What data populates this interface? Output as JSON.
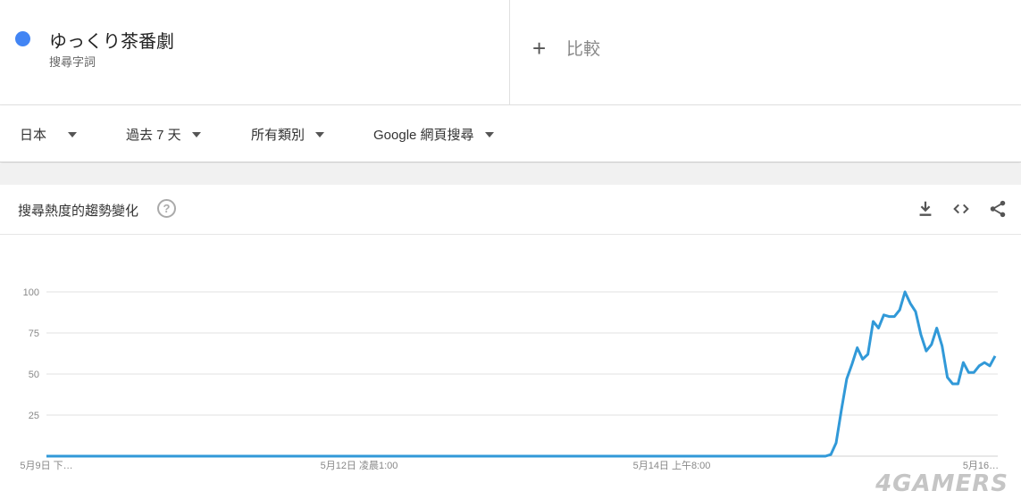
{
  "term": {
    "name": "ゆっくり茶番劇",
    "type": "搜尋字詞",
    "color": "#4285f4"
  },
  "compare": {
    "label": "比較",
    "icon": "plus-icon"
  },
  "filters": [
    {
      "label": "日本"
    },
    {
      "label": "過去 7 天"
    },
    {
      "label": "所有類別"
    },
    {
      "label": "Google 網頁搜尋"
    }
  ],
  "chart_header": {
    "title": "搜尋熱度的趨勢變化",
    "help_icon": "?",
    "icons": [
      "download-icon",
      "embed-icon",
      "share-icon"
    ]
  },
  "chart_data": {
    "type": "line",
    "title": "",
    "xlabel": "",
    "ylabel": "",
    "ylim": [
      0,
      100
    ],
    "yticks": [
      "25",
      "50",
      "75",
      "100"
    ],
    "x_tick_labels": [
      "5月9日 下…",
      "5月12日 凌晨1:00",
      "5月14日 上午8:00",
      "5月16…"
    ],
    "line_color": "#3199d8",
    "grid": true,
    "series": [
      {
        "values": [
          0,
          0,
          0,
          0,
          0,
          0,
          0,
          0,
          0,
          0,
          0,
          0,
          0,
          0,
          0,
          0,
          0,
          0,
          0,
          0,
          0,
          0,
          0,
          0,
          0,
          0,
          0,
          0,
          0,
          0,
          0,
          0,
          0,
          0,
          0,
          0,
          0,
          0,
          0,
          0,
          0,
          0,
          0,
          0,
          0,
          0,
          0,
          0,
          0,
          0,
          0,
          0,
          0,
          0,
          0,
          0,
          0,
          0,
          0,
          0,
          0,
          0,
          0,
          0,
          0,
          0,
          0,
          0,
          0,
          0,
          0,
          0,
          0,
          0,
          0,
          0,
          0,
          0,
          0,
          0,
          0,
          0,
          0,
          0,
          0,
          0,
          0,
          0,
          0,
          0,
          0,
          0,
          0,
          0,
          0,
          0,
          0,
          0,
          0,
          0,
          0,
          0,
          0,
          0,
          0,
          0,
          0,
          0,
          0,
          0,
          0,
          0,
          0,
          0,
          0,
          0,
          0,
          0,
          0,
          0,
          0,
          0,
          0,
          0,
          0,
          0,
          0,
          0,
          0,
          0,
          0,
          0,
          0,
          0,
          0,
          0,
          0,
          0,
          0,
          0,
          0,
          0,
          0,
          0,
          0,
          0,
          0,
          0,
          1,
          8,
          28,
          47,
          56,
          66,
          59,
          62,
          82,
          78,
          86,
          85,
          85,
          89,
          100,
          93,
          88,
          74,
          64,
          68,
          78,
          67,
          48,
          44,
          44,
          57,
          51,
          51,
          55,
          57,
          55,
          61
        ]
      }
    ]
  },
  "watermark": "4GAMERS"
}
